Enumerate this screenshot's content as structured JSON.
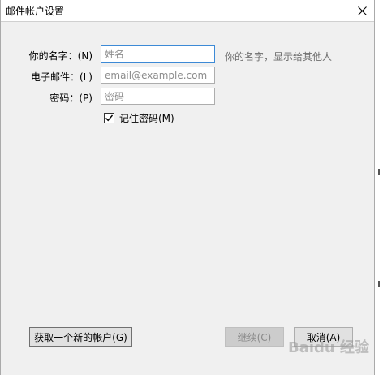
{
  "window": {
    "title": "邮件帐户设置"
  },
  "form": {
    "name_label": "你的名字：(N)",
    "name_placeholder": "姓名",
    "name_hint": "你的名字，显示给其他人",
    "email_label": "电子邮件：(L)",
    "email_placeholder": "email@example.com",
    "password_label": "密码：(P)",
    "password_placeholder": "密码",
    "remember_label": "记住密码(M)",
    "remember_checked": true
  },
  "buttons": {
    "new_account": "获取一个新的帐户(G)",
    "continue": "继续(C)",
    "cancel": "取消(A)"
  },
  "watermark": "Baidu 经验",
  "icons": {
    "close": "close-icon",
    "check": "checkmark-icon"
  }
}
